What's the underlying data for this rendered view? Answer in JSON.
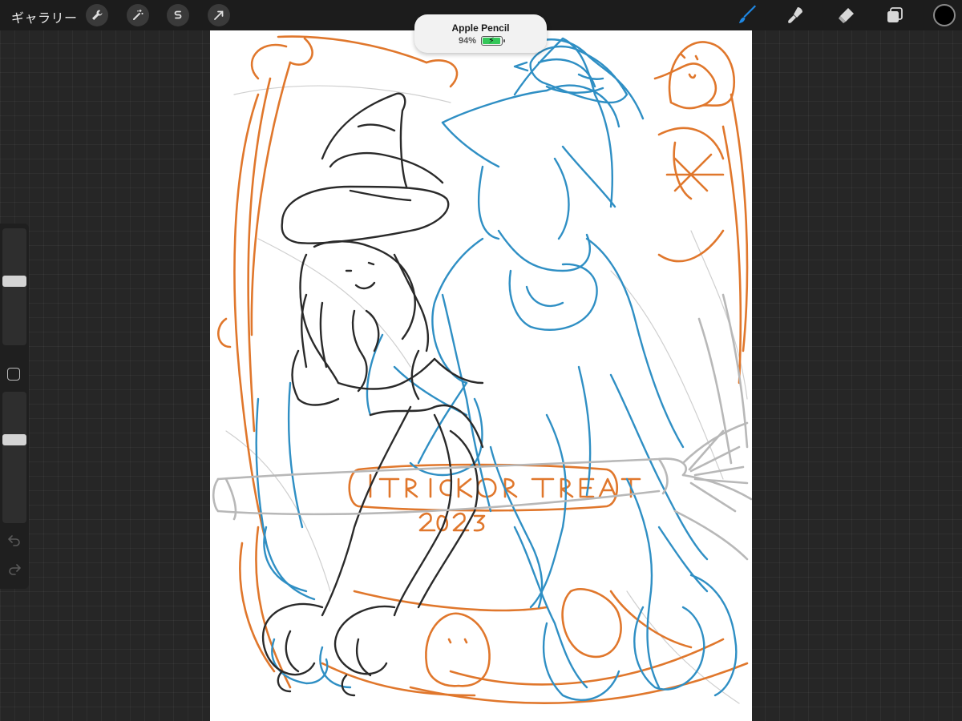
{
  "toolbar": {
    "gallery_label": "ギャラリー",
    "left_tools": [
      "wrench-icon",
      "magic-wand-icon",
      "selection-s-icon",
      "transform-arrow-icon"
    ],
    "right_tools": [
      "brush-icon",
      "smudge-icon",
      "eraser-icon",
      "layers-icon"
    ],
    "active_tool": "brush-icon",
    "active_tool_color": "#1e88e5",
    "current_color": "#000000"
  },
  "toast": {
    "title": "Apple Pencil",
    "battery_percent": "94%",
    "battery_level": 0.94,
    "battery_color": "#34c759"
  },
  "sidebar": {
    "brush_size_level": 0.55,
    "opacity_level": 0.65
  },
  "canvas": {
    "background": "#ffffff",
    "stroke_colors": [
      "#e0772c",
      "#2f8fc4",
      "#2a2a2a",
      "#b8b8b8"
    ],
    "banner_text": "TRICK OR TREAT",
    "banner_year": "2023"
  }
}
